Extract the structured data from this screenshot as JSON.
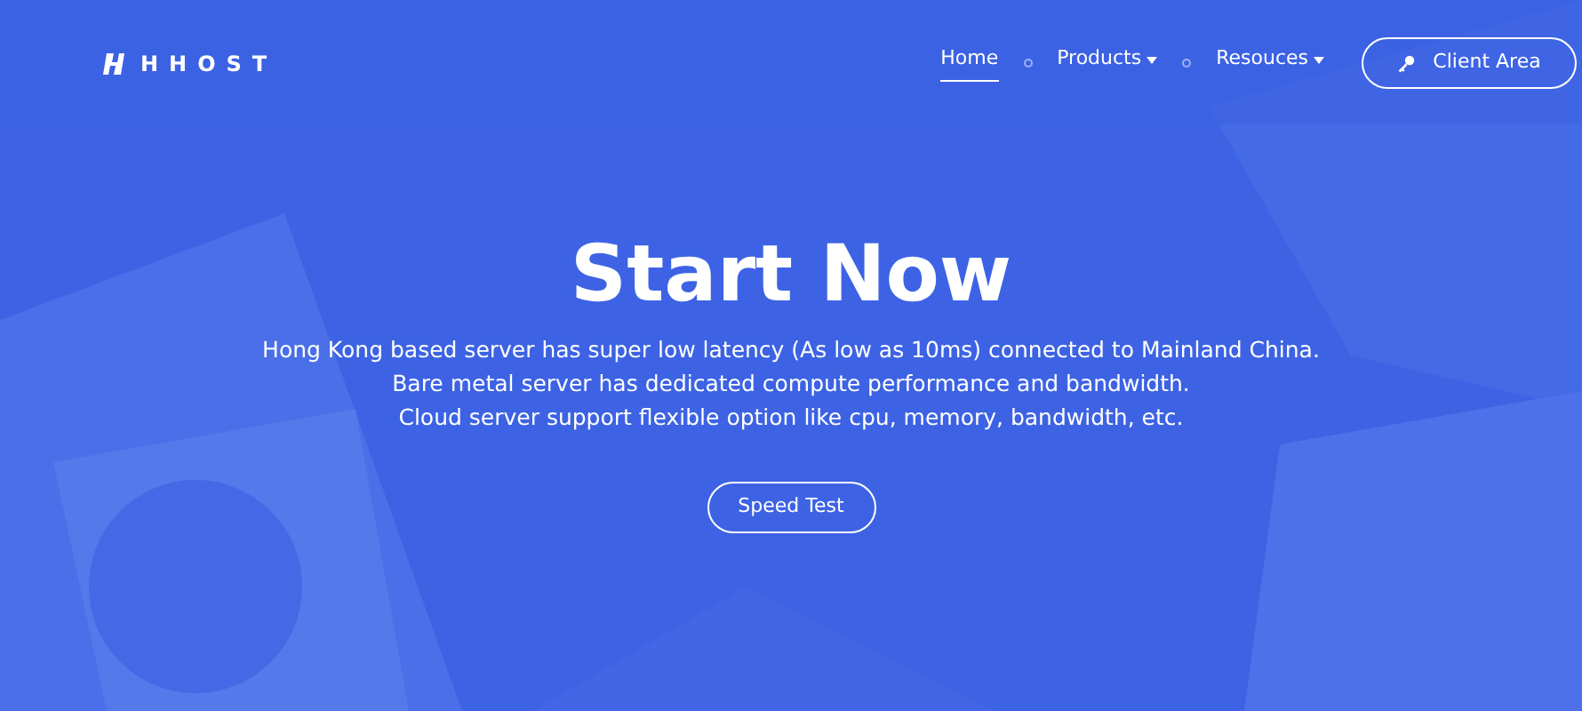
{
  "logo": {
    "text": "HHOST"
  },
  "nav": [
    {
      "label": "Home",
      "selected": true,
      "dropdown": false
    },
    {
      "label": "Products",
      "selected": false,
      "dropdown": true
    },
    {
      "label": "Resouces",
      "selected": false,
      "dropdown": true
    }
  ],
  "client_button": {
    "label": "Client Area"
  },
  "hero": {
    "title": "Start Now",
    "lines": [
      "Hong Kong based server has super low latency (As low as 10ms) connected to Mainland China.",
      "Bare metal server has dedicated compute performance and bandwidth.",
      "Cloud server support flexible option like cpu, memory, bandwidth, etc."
    ],
    "button": "Speed Test"
  }
}
